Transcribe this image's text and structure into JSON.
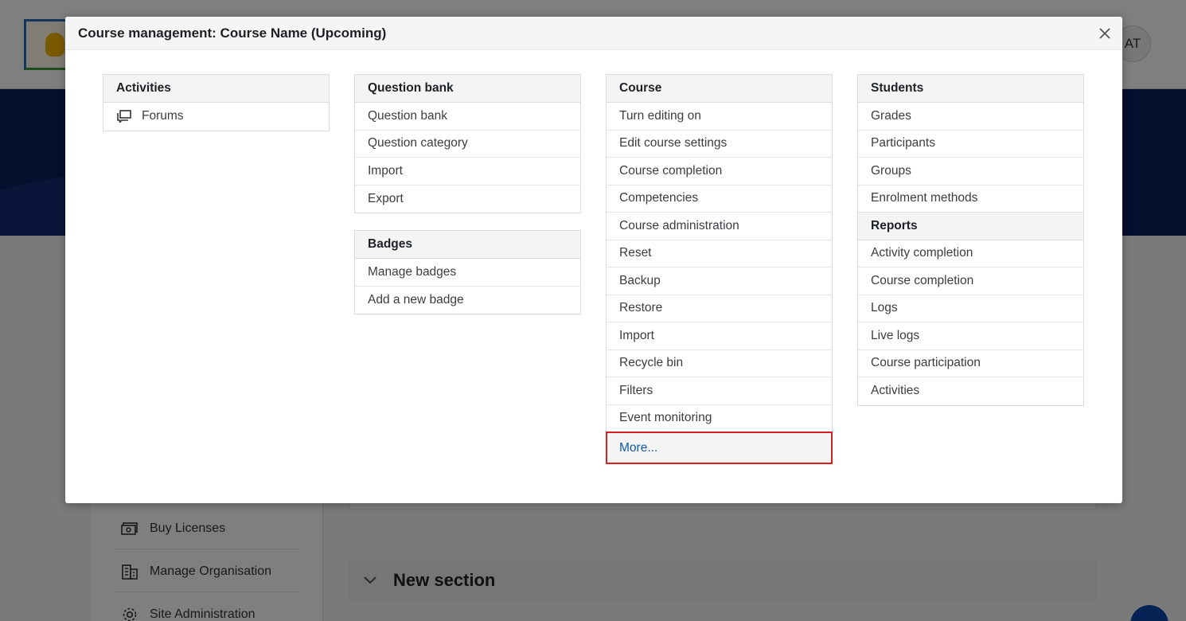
{
  "background": {
    "avatar_initials": "AT",
    "sidebar_items": [
      {
        "label": "Buy Licenses",
        "icon": "money-icon"
      },
      {
        "label": "Manage Organisation",
        "icon": "building-icon"
      },
      {
        "label": "Site Administration",
        "icon": "gear-icon"
      }
    ],
    "section_title": "New section"
  },
  "modal": {
    "title": "Course management: Course Name (Upcoming)",
    "close_icon": "close-icon",
    "activities": {
      "heading": "Activities",
      "items": [
        {
          "label": "Forums",
          "icon": "forum-icon"
        }
      ]
    },
    "question_bank": {
      "heading": "Question bank",
      "items": [
        "Question bank",
        "Question category",
        "Import",
        "Export"
      ]
    },
    "badges": {
      "heading": "Badges",
      "items": [
        "Manage badges",
        "Add a new badge"
      ]
    },
    "course": {
      "heading": "Course",
      "items": [
        "Turn editing on",
        "Edit course settings",
        "Course completion",
        "Competencies",
        "Course administration",
        "Reset",
        "Backup",
        "Restore",
        "Import",
        "Recycle bin",
        "Filters",
        "Event monitoring"
      ],
      "more_label": "More..."
    },
    "students": {
      "heading": "Students",
      "items": [
        "Grades",
        "Participants",
        "Groups",
        "Enrolment methods"
      ]
    },
    "reports": {
      "heading": "Reports",
      "items": [
        "Activity completion",
        "Course completion",
        "Logs",
        "Live logs",
        "Course participation",
        "Activities"
      ]
    }
  },
  "colors": {
    "banner": "#0b1f5c",
    "link": "#0f5aa8",
    "highlight_border": "#d32020"
  }
}
